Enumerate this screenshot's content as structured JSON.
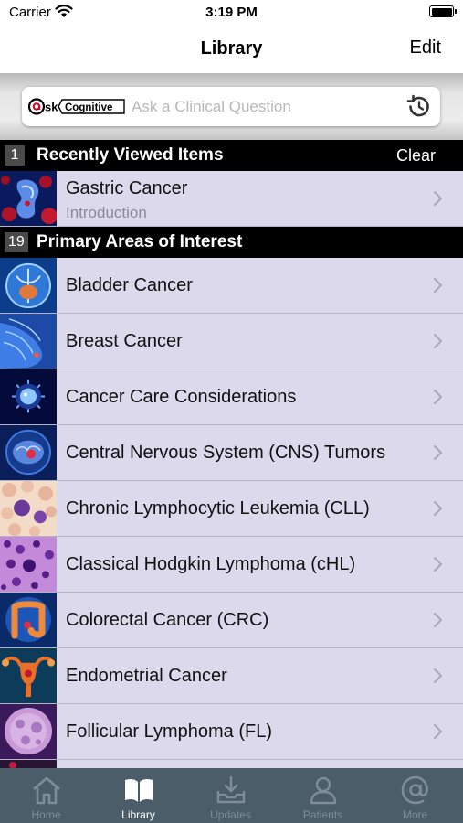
{
  "status_bar": {
    "carrier": "Carrier",
    "time": "3:19 PM"
  },
  "nav": {
    "title": "Library",
    "edit_label": "Edit"
  },
  "search": {
    "logo_text_ask": "sk",
    "logo_text_brand": "Cognitive",
    "placeholder": "Ask a Clinical Question"
  },
  "recent": {
    "count": "1",
    "title": "Recently Viewed Items",
    "clear_label": "Clear",
    "items": [
      {
        "label": "Gastric Cancer",
        "sublabel": "Introduction",
        "icon": "gastric-thumbnail"
      }
    ]
  },
  "primary": {
    "count": "19",
    "title": "Primary Areas of Interest",
    "items": [
      {
        "label": "Bladder Cancer",
        "icon": "bladder-thumbnail"
      },
      {
        "label": "Breast Cancer",
        "icon": "breast-thumbnail"
      },
      {
        "label": "Cancer Care Considerations",
        "icon": "cancer-cell-thumbnail"
      },
      {
        "label": "Central Nervous System (CNS) Tumors",
        "icon": "brain-thumbnail"
      },
      {
        "label": "Chronic Lymphocytic Leukemia (CLL)",
        "icon": "blood-cells-thumbnail"
      },
      {
        "label": "Classical Hodgkin Lymphoma (cHL)",
        "icon": "tissue-stain-thumbnail"
      },
      {
        "label": "Colorectal Cancer (CRC)",
        "icon": "colon-thumbnail"
      },
      {
        "label": "Endometrial Cancer",
        "icon": "uterus-thumbnail"
      },
      {
        "label": "Follicular Lymphoma (FL)",
        "icon": "follicle-thumbnail"
      }
    ]
  },
  "tabs": [
    {
      "label": "Home",
      "icon": "home-icon"
    },
    {
      "label": "Library",
      "icon": "book-icon",
      "active": true
    },
    {
      "label": "Updates",
      "icon": "inbox-download-icon"
    },
    {
      "label": "Patients",
      "icon": "person-icon"
    },
    {
      "label": "More",
      "icon": "at-sign-icon"
    }
  ],
  "colors": {
    "row_bg": "#dcd9ec",
    "header_bg": "#000000",
    "tab_bar_bg": "#4c5d6a",
    "tab_inactive": "#7d8d9a",
    "tab_active": "#ffffff"
  }
}
